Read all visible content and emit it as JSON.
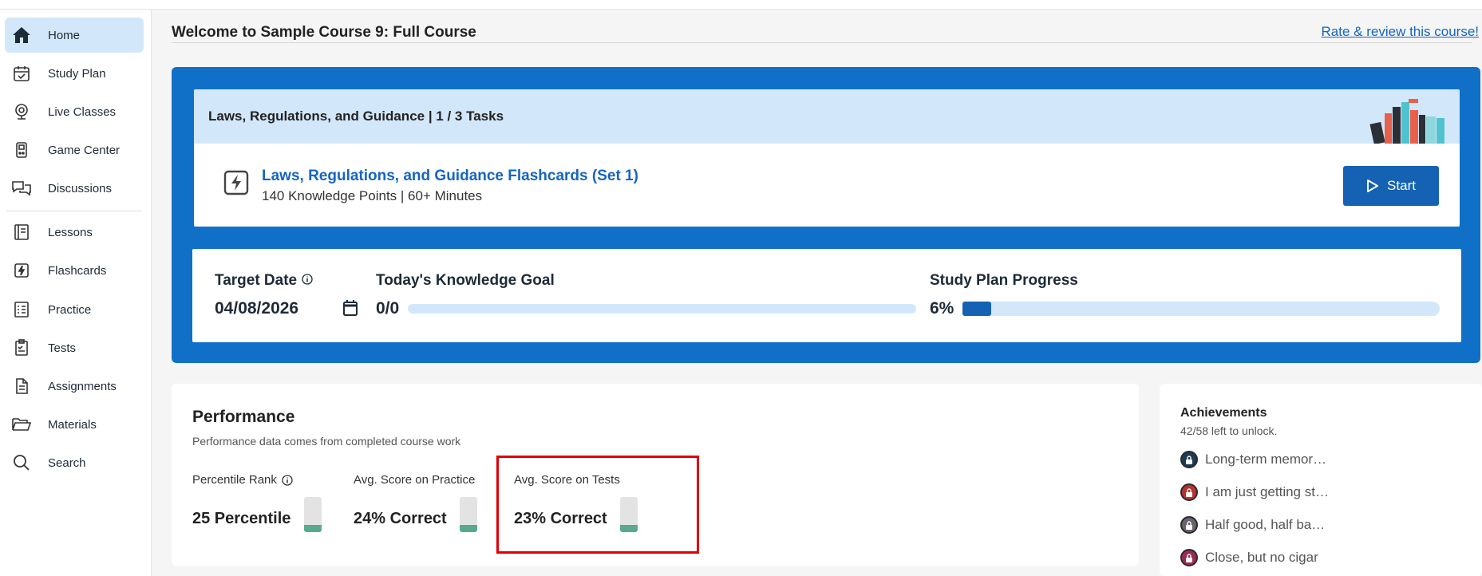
{
  "sidebar": {
    "items": [
      {
        "label": "Home",
        "icon": "home-icon"
      },
      {
        "label": "Study Plan",
        "icon": "calendar-check-icon"
      },
      {
        "label": "Live Classes",
        "icon": "webcam-icon"
      },
      {
        "label": "Game Center",
        "icon": "game-console-icon"
      },
      {
        "label": "Discussions",
        "icon": "chat-bubbles-icon"
      },
      {
        "label": "Lessons",
        "icon": "book-icon"
      },
      {
        "label": "Flashcards",
        "icon": "flashcard-bolt-icon"
      },
      {
        "label": "Practice",
        "icon": "checklist-icon"
      },
      {
        "label": "Tests",
        "icon": "clipboard-icon"
      },
      {
        "label": "Assignments",
        "icon": "document-icon"
      },
      {
        "label": "Materials",
        "icon": "folder-open-icon"
      },
      {
        "label": "Search",
        "icon": "search-icon"
      }
    ]
  },
  "header": {
    "welcome": "Welcome to Sample Course 9: Full Course",
    "rate_link": "Rate & review this course!"
  },
  "task": {
    "heading": "Laws, Regulations, and Guidance | 1 / 3 Tasks",
    "title": "Laws, Regulations, and Guidance Flashcards (Set 1)",
    "meta": "140 Knowledge Points |  60+ Minutes",
    "start_label": "Start"
  },
  "goals": {
    "target_date_label": "Target Date",
    "target_date_value": "04/08/2026",
    "knowledge_goal_label": "Today's Knowledge Goal",
    "knowledge_goal_value": "0/0",
    "knowledge_goal_fraction": 0,
    "progress_label": "Study Plan Progress",
    "progress_value": "6%",
    "progress_fraction": 0.06
  },
  "performance": {
    "title": "Performance",
    "subtitle": "Performance data comes from completed course work",
    "stats": [
      {
        "label": "Percentile Rank",
        "value": "25 Percentile",
        "level": 0.25
      },
      {
        "label": "Avg. Score on Practice",
        "value": "24% Correct",
        "level": 0.24
      },
      {
        "label": "Avg. Score on Tests",
        "value": "23% Correct",
        "level": 0.23
      }
    ]
  },
  "achievements": {
    "title": "Achievements",
    "subtitle": "42/58 left to unlock.",
    "items": [
      {
        "label": "Long-term memor…",
        "color": "#1d3b52"
      },
      {
        "label": "I am just getting st…",
        "color": "#b8322e"
      },
      {
        "label": "Half good, half ba…",
        "color": "#6b6170"
      },
      {
        "label": "Close, but no cigar",
        "color": "#9e2b4f"
      }
    ]
  },
  "colors": {
    "brand_blue": "#1070c8",
    "accent_blue": "#1565c0",
    "light_blue": "#d3e7fb",
    "meter_green": "#58a990",
    "highlight_red": "#e00000"
  }
}
